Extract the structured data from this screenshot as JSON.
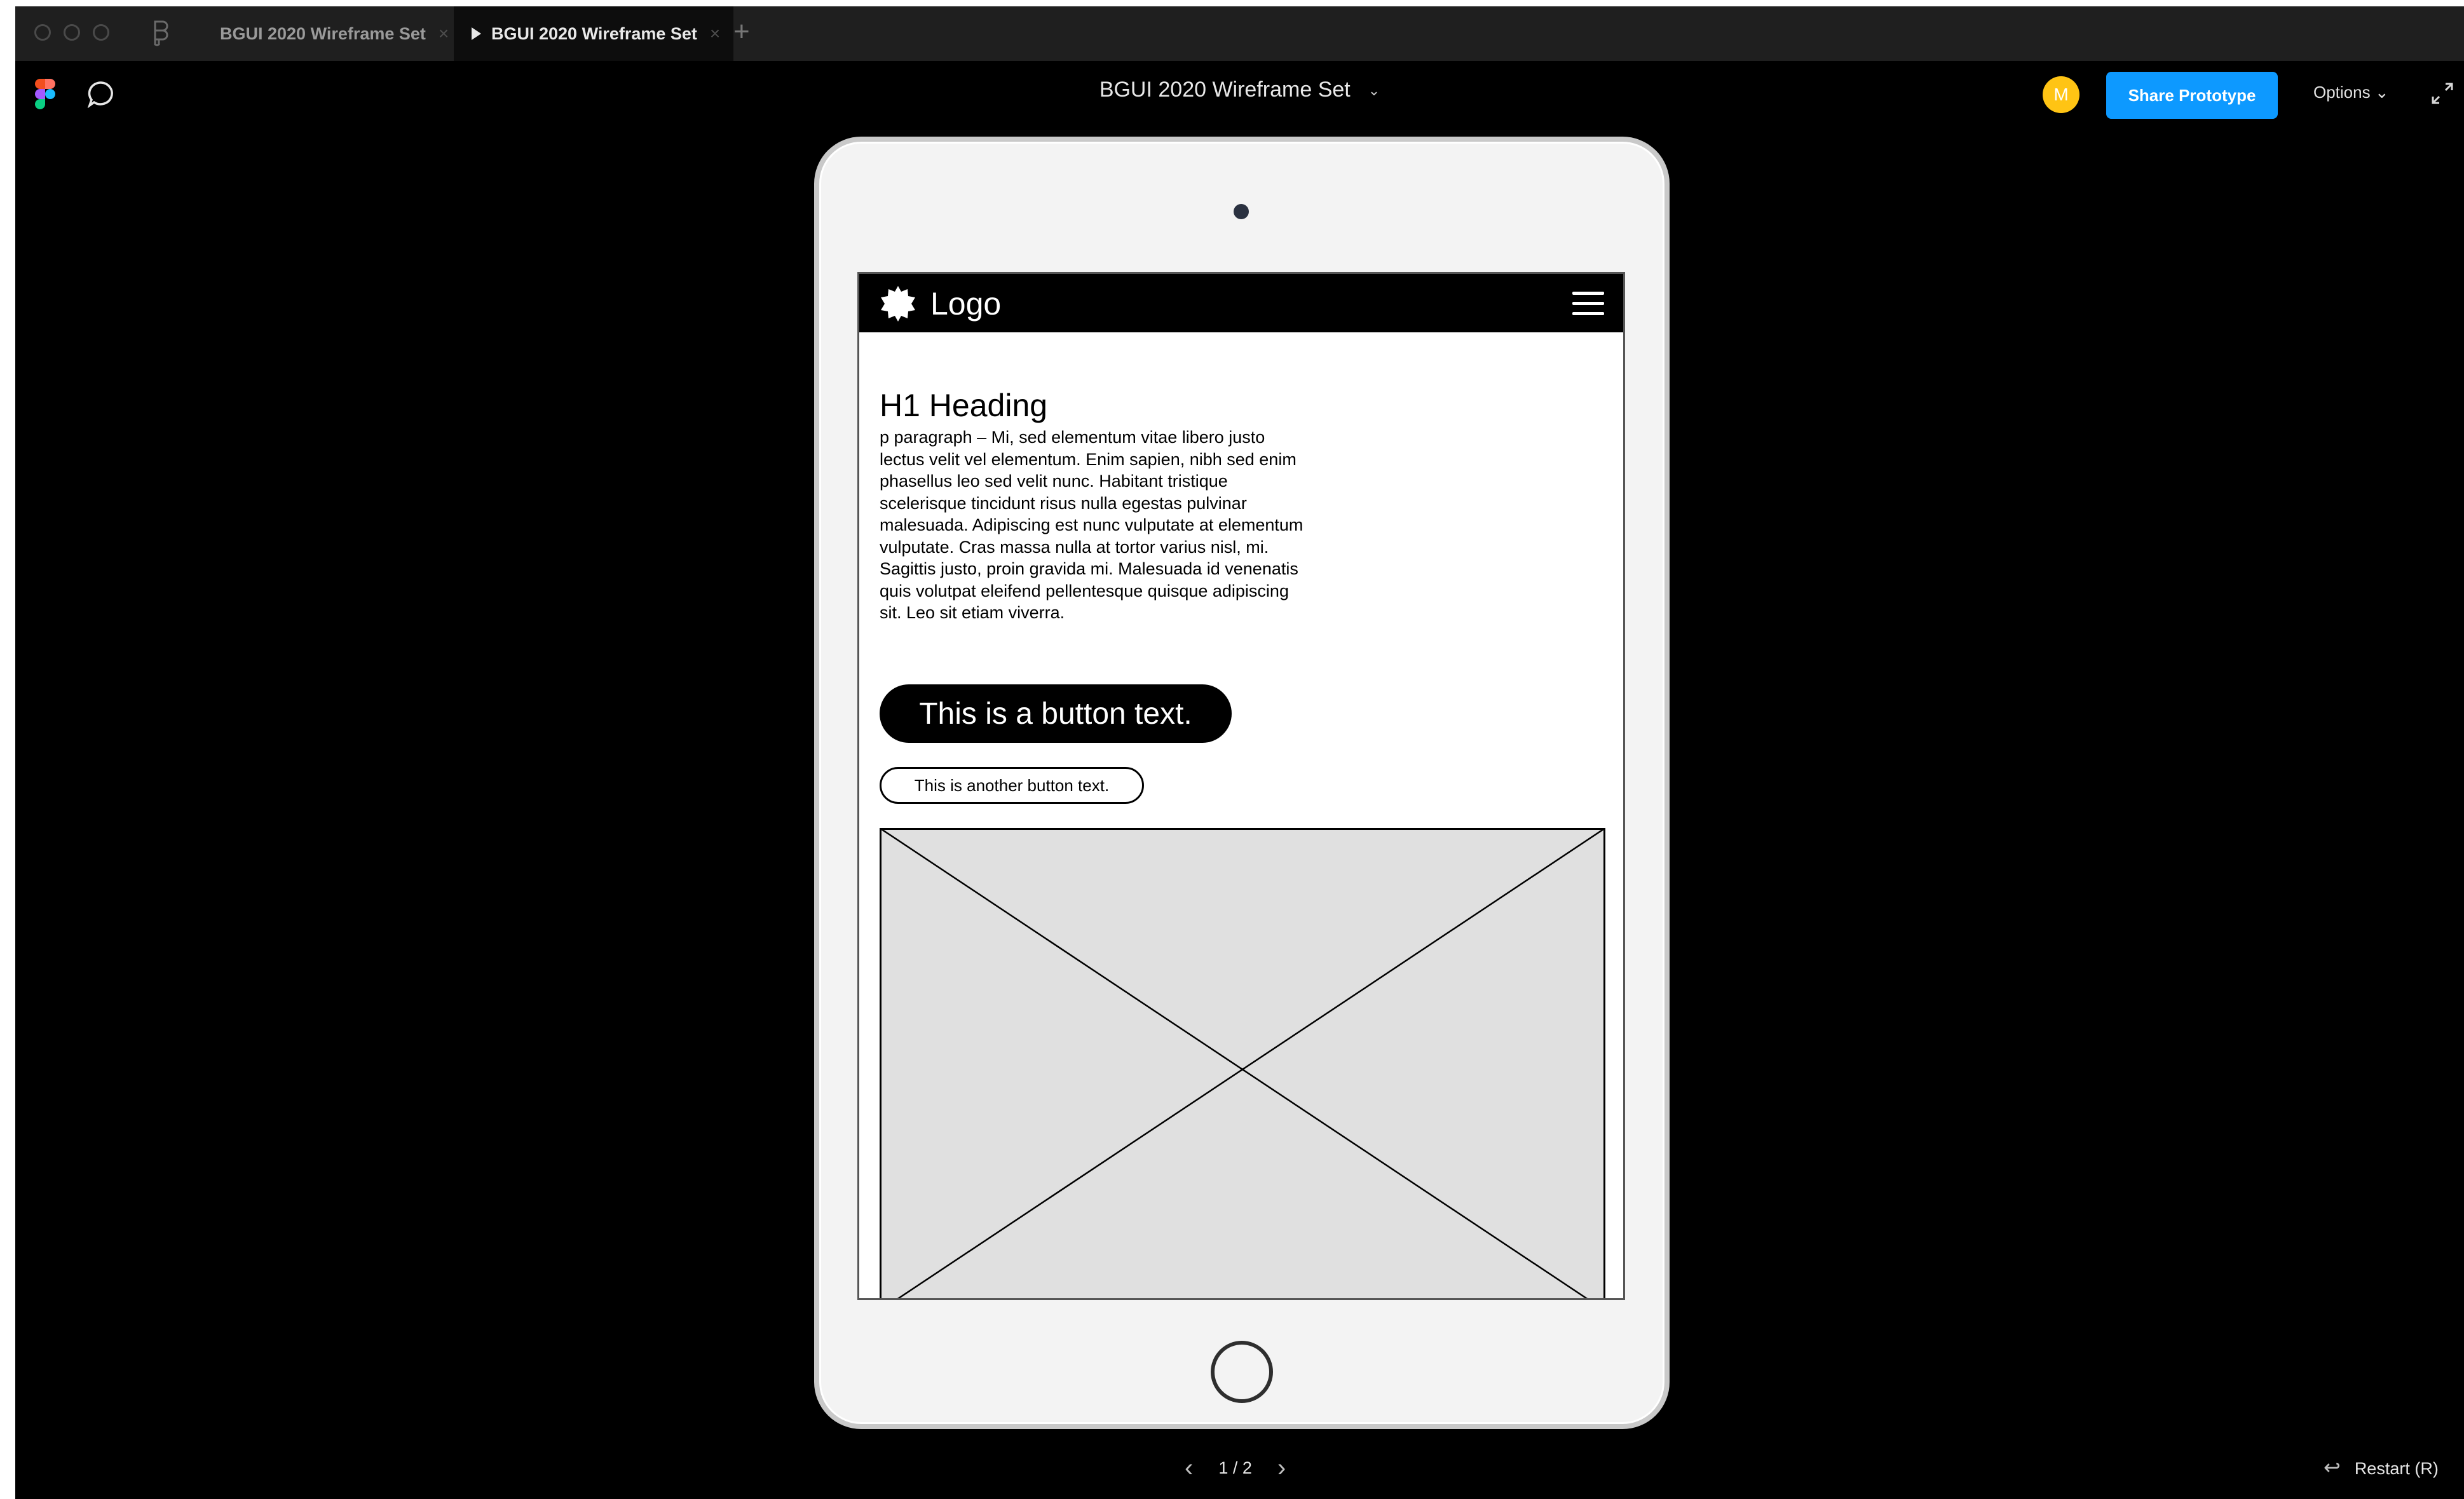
{
  "tabs": [
    {
      "label": "BGUI 2020 Wireframe Set",
      "active": false
    },
    {
      "label": "BGUI 2020 Wireframe Set",
      "active": true
    }
  ],
  "tab_close_glyph": "×",
  "new_tab_glyph": "+",
  "toolbar": {
    "title": "BGUI 2020 Wireframe Set",
    "title_caret": "⌄",
    "avatar_initial": "M",
    "share_label": "Share Prototype",
    "options_label": "Options ⌄"
  },
  "prototype": {
    "logo_text": "Logo",
    "heading": "H1 Heading",
    "paragraph": "p paragraph – Mi, sed elementum vitae libero justo lectus velit vel elementum. Enim sapien, nibh sed enim phasellus leo sed velit nunc. Habitant tristique scelerisque tincidunt risus nulla egestas pulvinar malesuada. Adipiscing est nunc vulputate at elementum vulputate. Cras massa nulla at tortor varius nisl, mi. Sagittis justo, proin gravida mi. Malesuada id venenatis quis volutpat eleifend pellentesque quisque adipiscing sit. Leo sit etiam viverra.",
    "primary_button": "This is a button text.",
    "secondary_button": "This is another button text."
  },
  "pager": {
    "prev": "‹",
    "label": "1 / 2",
    "next": "›"
  },
  "restart": {
    "arrow": "↩",
    "label": "Restart (R)"
  },
  "colors": {
    "share_button": "#0d99ff",
    "avatar": "#ffc414",
    "canvas": "#000000",
    "device": "#f3f3f3"
  },
  "icons": [
    "figma-logo-icon",
    "comment-icon",
    "figma-menu-icon",
    "fullscreen-icon",
    "hamburger-menu-icon",
    "logo-mark-icon",
    "image-placeholder-icon"
  ]
}
